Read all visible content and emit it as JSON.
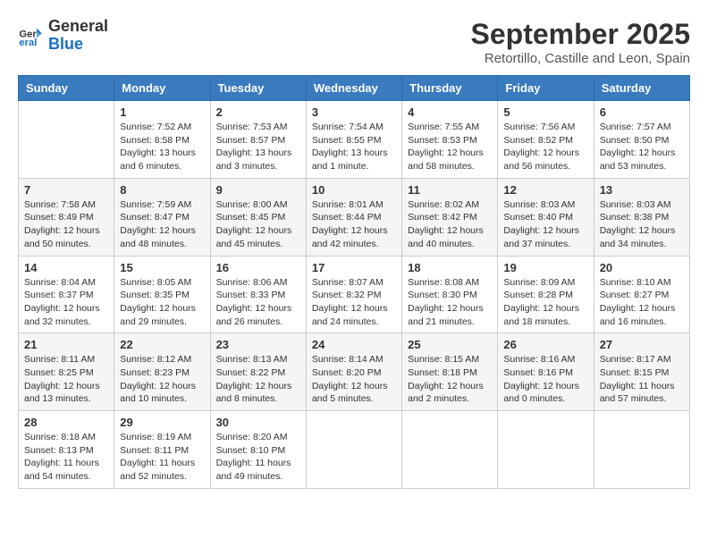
{
  "header": {
    "logo_line1": "General",
    "logo_line2": "Blue",
    "month": "September 2025",
    "location": "Retortillo, Castille and Leon, Spain"
  },
  "weekdays": [
    "Sunday",
    "Monday",
    "Tuesday",
    "Wednesday",
    "Thursday",
    "Friday",
    "Saturday"
  ],
  "weeks": [
    [
      {
        "day": "",
        "sunrise": "",
        "sunset": "",
        "daylight": ""
      },
      {
        "day": "1",
        "sunrise": "Sunrise: 7:52 AM",
        "sunset": "Sunset: 8:58 PM",
        "daylight": "Daylight: 13 hours and 6 minutes."
      },
      {
        "day": "2",
        "sunrise": "Sunrise: 7:53 AM",
        "sunset": "Sunset: 8:57 PM",
        "daylight": "Daylight: 13 hours and 3 minutes."
      },
      {
        "day": "3",
        "sunrise": "Sunrise: 7:54 AM",
        "sunset": "Sunset: 8:55 PM",
        "daylight": "Daylight: 13 hours and 1 minute."
      },
      {
        "day": "4",
        "sunrise": "Sunrise: 7:55 AM",
        "sunset": "Sunset: 8:53 PM",
        "daylight": "Daylight: 12 hours and 58 minutes."
      },
      {
        "day": "5",
        "sunrise": "Sunrise: 7:56 AM",
        "sunset": "Sunset: 8:52 PM",
        "daylight": "Daylight: 12 hours and 56 minutes."
      },
      {
        "day": "6",
        "sunrise": "Sunrise: 7:57 AM",
        "sunset": "Sunset: 8:50 PM",
        "daylight": "Daylight: 12 hours and 53 minutes."
      }
    ],
    [
      {
        "day": "7",
        "sunrise": "Sunrise: 7:58 AM",
        "sunset": "Sunset: 8:49 PM",
        "daylight": "Daylight: 12 hours and 50 minutes."
      },
      {
        "day": "8",
        "sunrise": "Sunrise: 7:59 AM",
        "sunset": "Sunset: 8:47 PM",
        "daylight": "Daylight: 12 hours and 48 minutes."
      },
      {
        "day": "9",
        "sunrise": "Sunrise: 8:00 AM",
        "sunset": "Sunset: 8:45 PM",
        "daylight": "Daylight: 12 hours and 45 minutes."
      },
      {
        "day": "10",
        "sunrise": "Sunrise: 8:01 AM",
        "sunset": "Sunset: 8:44 PM",
        "daylight": "Daylight: 12 hours and 42 minutes."
      },
      {
        "day": "11",
        "sunrise": "Sunrise: 8:02 AM",
        "sunset": "Sunset: 8:42 PM",
        "daylight": "Daylight: 12 hours and 40 minutes."
      },
      {
        "day": "12",
        "sunrise": "Sunrise: 8:03 AM",
        "sunset": "Sunset: 8:40 PM",
        "daylight": "Daylight: 12 hours and 37 minutes."
      },
      {
        "day": "13",
        "sunrise": "Sunrise: 8:03 AM",
        "sunset": "Sunset: 8:38 PM",
        "daylight": "Daylight: 12 hours and 34 minutes."
      }
    ],
    [
      {
        "day": "14",
        "sunrise": "Sunrise: 8:04 AM",
        "sunset": "Sunset: 8:37 PM",
        "daylight": "Daylight: 12 hours and 32 minutes."
      },
      {
        "day": "15",
        "sunrise": "Sunrise: 8:05 AM",
        "sunset": "Sunset: 8:35 PM",
        "daylight": "Daylight: 12 hours and 29 minutes."
      },
      {
        "day": "16",
        "sunrise": "Sunrise: 8:06 AM",
        "sunset": "Sunset: 8:33 PM",
        "daylight": "Daylight: 12 hours and 26 minutes."
      },
      {
        "day": "17",
        "sunrise": "Sunrise: 8:07 AM",
        "sunset": "Sunset: 8:32 PM",
        "daylight": "Daylight: 12 hours and 24 minutes."
      },
      {
        "day": "18",
        "sunrise": "Sunrise: 8:08 AM",
        "sunset": "Sunset: 8:30 PM",
        "daylight": "Daylight: 12 hours and 21 minutes."
      },
      {
        "day": "19",
        "sunrise": "Sunrise: 8:09 AM",
        "sunset": "Sunset: 8:28 PM",
        "daylight": "Daylight: 12 hours and 18 minutes."
      },
      {
        "day": "20",
        "sunrise": "Sunrise: 8:10 AM",
        "sunset": "Sunset: 8:27 PM",
        "daylight": "Daylight: 12 hours and 16 minutes."
      }
    ],
    [
      {
        "day": "21",
        "sunrise": "Sunrise: 8:11 AM",
        "sunset": "Sunset: 8:25 PM",
        "daylight": "Daylight: 12 hours and 13 minutes."
      },
      {
        "day": "22",
        "sunrise": "Sunrise: 8:12 AM",
        "sunset": "Sunset: 8:23 PM",
        "daylight": "Daylight: 12 hours and 10 minutes."
      },
      {
        "day": "23",
        "sunrise": "Sunrise: 8:13 AM",
        "sunset": "Sunset: 8:22 PM",
        "daylight": "Daylight: 12 hours and 8 minutes."
      },
      {
        "day": "24",
        "sunrise": "Sunrise: 8:14 AM",
        "sunset": "Sunset: 8:20 PM",
        "daylight": "Daylight: 12 hours and 5 minutes."
      },
      {
        "day": "25",
        "sunrise": "Sunrise: 8:15 AM",
        "sunset": "Sunset: 8:18 PM",
        "daylight": "Daylight: 12 hours and 2 minutes."
      },
      {
        "day": "26",
        "sunrise": "Sunrise: 8:16 AM",
        "sunset": "Sunset: 8:16 PM",
        "daylight": "Daylight: 12 hours and 0 minutes."
      },
      {
        "day": "27",
        "sunrise": "Sunrise: 8:17 AM",
        "sunset": "Sunset: 8:15 PM",
        "daylight": "Daylight: 11 hours and 57 minutes."
      }
    ],
    [
      {
        "day": "28",
        "sunrise": "Sunrise: 8:18 AM",
        "sunset": "Sunset: 8:13 PM",
        "daylight": "Daylight: 11 hours and 54 minutes."
      },
      {
        "day": "29",
        "sunrise": "Sunrise: 8:19 AM",
        "sunset": "Sunset: 8:11 PM",
        "daylight": "Daylight: 11 hours and 52 minutes."
      },
      {
        "day": "30",
        "sunrise": "Sunrise: 8:20 AM",
        "sunset": "Sunset: 8:10 PM",
        "daylight": "Daylight: 11 hours and 49 minutes."
      },
      {
        "day": "",
        "sunrise": "",
        "sunset": "",
        "daylight": ""
      },
      {
        "day": "",
        "sunrise": "",
        "sunset": "",
        "daylight": ""
      },
      {
        "day": "",
        "sunrise": "",
        "sunset": "",
        "daylight": ""
      },
      {
        "day": "",
        "sunrise": "",
        "sunset": "",
        "daylight": ""
      }
    ]
  ]
}
